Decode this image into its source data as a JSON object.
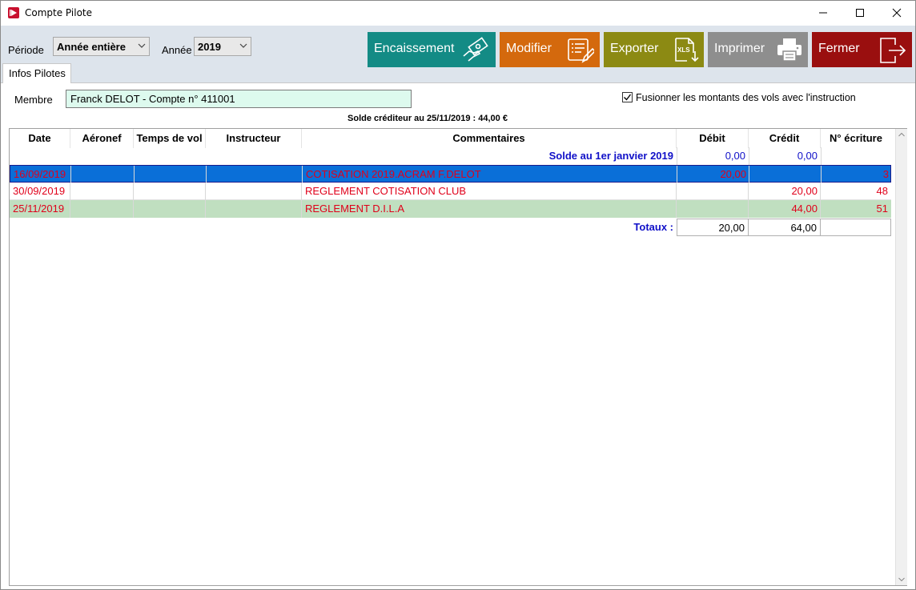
{
  "window": {
    "title": "Compte Pilote"
  },
  "toolbar": {
    "periode_label": "Période",
    "periode_value": "Année entière",
    "annee_label": "Année",
    "annee_value": "2019",
    "buttons": {
      "encaissement": "Encaissement",
      "modifier": "Modifier",
      "exporter": "Exporter",
      "exporter_icon_text": "XLS",
      "imprimer": "Imprimer",
      "fermer": "Fermer"
    }
  },
  "tab": {
    "label": "Infos Pilotes"
  },
  "form": {
    "membre_label": "Membre",
    "membre_value": "Franck DELOT - Compte n° 411001",
    "fusion_label": "Fusionner les montants des vols avec l'instruction",
    "fusion_checked": true,
    "solde_text": "Solde créditeur au 25/11/2019 : 44,00 €"
  },
  "table": {
    "headers": [
      "Date",
      "Aéronef",
      "Temps de vol",
      "Instructeur",
      "Commentaires",
      "Débit",
      "Crédit",
      "N° écriture"
    ],
    "opening": {
      "label": "Solde au 1er janvier 2019",
      "debit": "0,00",
      "credit": "0,00"
    },
    "rows": [
      {
        "date": "16/09/2019",
        "aeronef": "",
        "temps": "",
        "instructeur": "",
        "commentaire": "COTISATION 2019.ACRAM F.DELOT",
        "debit": "20,00",
        "credit": "",
        "ecriture": "3"
      },
      {
        "date": "30/09/2019",
        "aeronef": "",
        "temps": "",
        "instructeur": "",
        "commentaire": "REGLEMENT COTISATION CLUB",
        "debit": "",
        "credit": "20,00",
        "ecriture": "48"
      },
      {
        "date": "25/11/2019",
        "aeronef": "",
        "temps": "",
        "instructeur": "",
        "commentaire": "REGLEMENT D.I.L.A",
        "debit": "",
        "credit": "44,00",
        "ecriture": "51"
      }
    ],
    "totals": {
      "label": "Totaux :",
      "debit": "20,00",
      "credit": "64,00"
    }
  },
  "colors": {
    "selected_row": "#0a6fd8",
    "alt_row": "#c0dfc0",
    "text_red": "#e0001a",
    "text_blue": "#1010c8"
  }
}
